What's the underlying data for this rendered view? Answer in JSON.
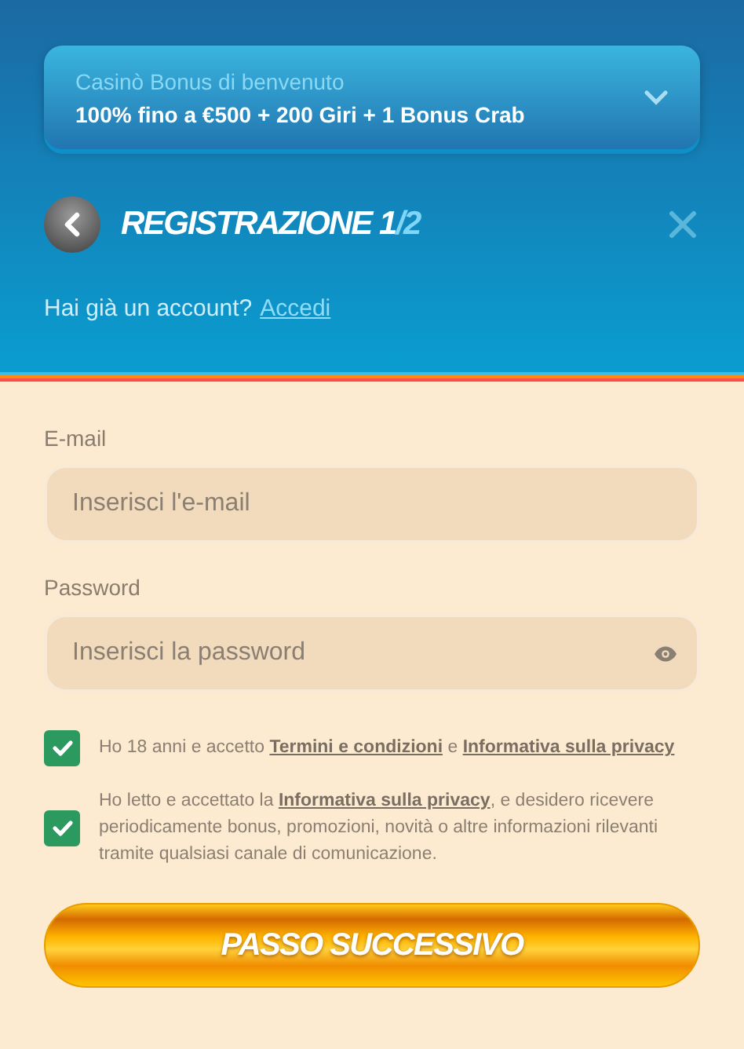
{
  "bonus": {
    "label": "Casinò Bonus di benvenuto",
    "offer": "100% fino a €500 + 200 Giri + 1 Bonus Crab",
    "expanded": false
  },
  "header": {
    "title_main": "REGISTRAZIONE 1",
    "title_suffix": "/2"
  },
  "login_prompt": {
    "text": "Hai già un account?",
    "link": "Accedi"
  },
  "fields": [
    {
      "kind": "email",
      "label": "E-mail",
      "placeholder": "Inserisci l'e-mail"
    },
    {
      "kind": "password",
      "label": "Password",
      "placeholder": "Inserisci la password"
    }
  ],
  "consents": [
    {
      "checked": true,
      "parts": [
        {
          "kind": "text",
          "text": "Ho 18 anni e accetto "
        },
        {
          "kind": "link",
          "text": "Termini e condizioni"
        },
        {
          "kind": "text",
          "text": " e "
        },
        {
          "kind": "link",
          "text": "Informativa sulla privacy"
        }
      ]
    },
    {
      "checked": true,
      "parts": [
        {
          "kind": "text",
          "text": "Ho letto e accettato la "
        },
        {
          "kind": "link",
          "text": "Informativa sulla privacy"
        },
        {
          "kind": "text",
          "text": ", e desidero ricevere periodicamente bonus, promozioni, novità o altre informazioni rilevanti tramite qualsiasi canale di comunicazione."
        }
      ]
    }
  ],
  "submit": "PASSO SUCCESSIVO"
}
